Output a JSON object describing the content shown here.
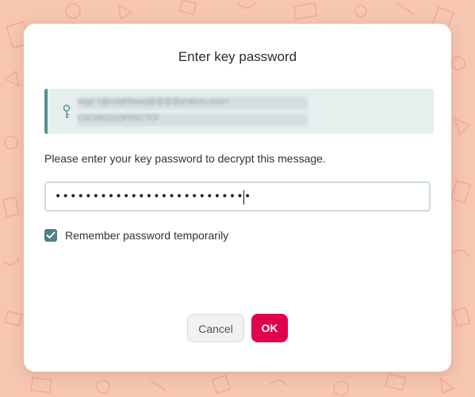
{
  "dialog": {
    "title": "Enter key password",
    "key_info": {
      "line1": "xxge <@xxlqhlbwxq@@@@yrabcru.xxxx>",
      "line2": "C0C0R1D1DFD5C7CF",
      "icon": "key-icon"
    },
    "instruction": "Please enter your key password to decrypt this message.",
    "password": {
      "value": "••••••••••••••••••••••••••",
      "masked": true
    },
    "remember": {
      "label": "Remember password temporarily",
      "checked": true,
      "icon": "checkmark-icon"
    },
    "buttons": {
      "cancel": "Cancel",
      "ok": "OK"
    }
  },
  "colors": {
    "background": "#f6c6b0",
    "accent_teal": "#4f7f86",
    "ok_button": "#e0004d"
  }
}
